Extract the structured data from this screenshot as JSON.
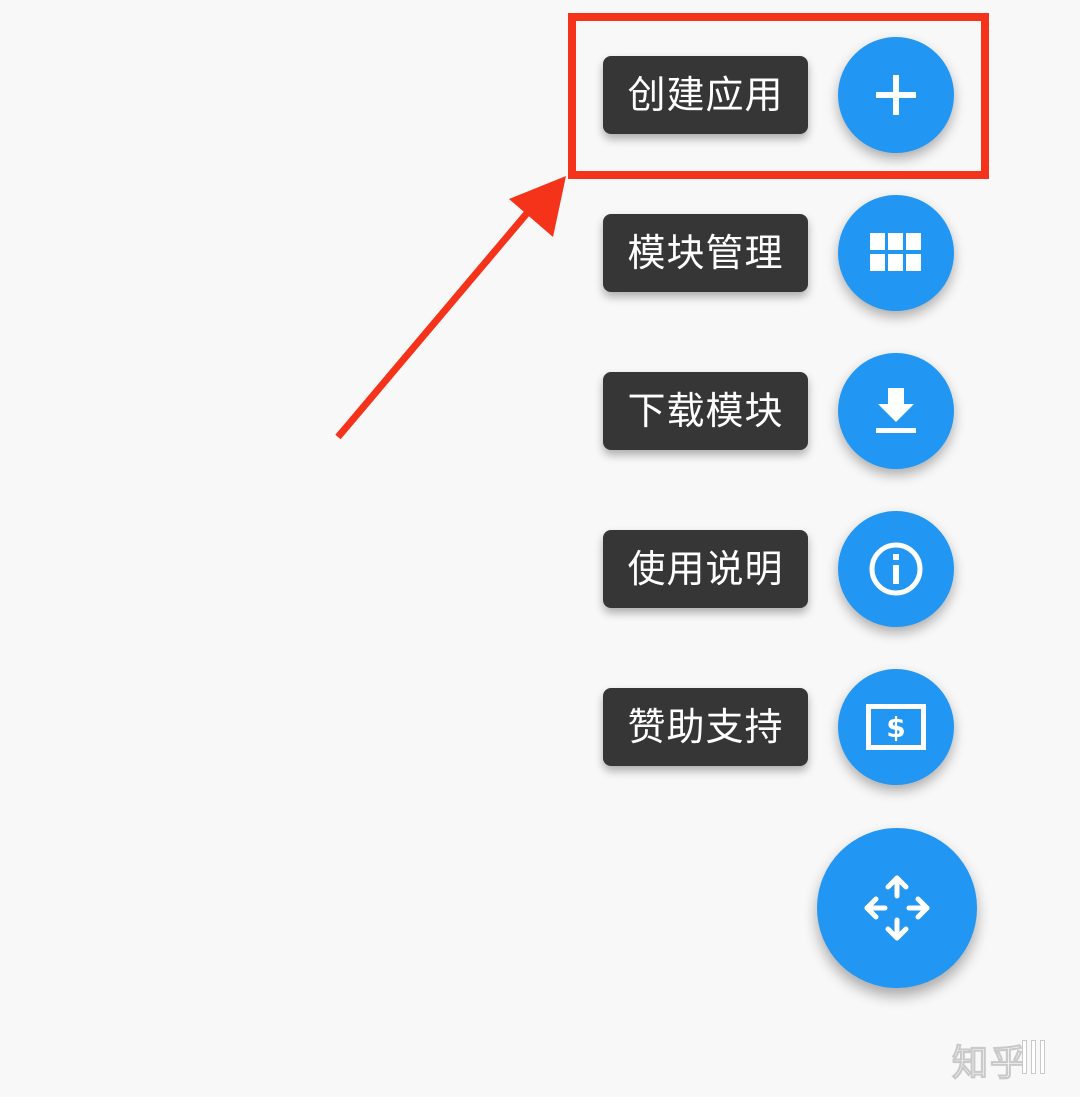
{
  "menu": {
    "items": [
      {
        "label": "创建应用",
        "icon": "add-icon"
      },
      {
        "label": "模块管理",
        "icon": "grid-icon"
      },
      {
        "label": "下载模块",
        "icon": "download-icon"
      },
      {
        "label": "使用说明",
        "icon": "info-icon"
      },
      {
        "label": "赞助支持",
        "icon": "money-icon"
      }
    ],
    "main_button_icon": "move-arrows-icon"
  },
  "annotation": {
    "highlight_color": "#f5321a"
  },
  "watermark": {
    "text": "知乎"
  },
  "colors": {
    "fab": "#2196f3",
    "label_bg": "#363636",
    "background": "#f8f8f8"
  }
}
